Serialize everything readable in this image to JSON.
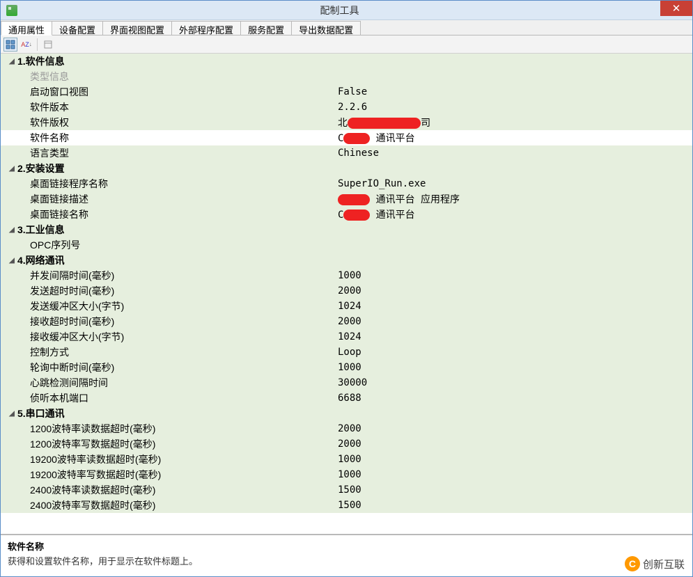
{
  "window": {
    "title": "配制工具"
  },
  "tabs": [
    {
      "label": "通用属性",
      "active": true
    },
    {
      "label": "设备配置"
    },
    {
      "label": "界面视图配置"
    },
    {
      "label": "外部程序配置"
    },
    {
      "label": "服务配置"
    },
    {
      "label": "导出数据配置"
    }
  ],
  "toolbar": {
    "categorized_icon": "categorized-icon",
    "alphabetical_icon": "alphabetical-icon",
    "property_pages_icon": "property-pages-icon"
  },
  "groups": [
    {
      "title": "1.软件信息",
      "rows": [
        {
          "label": "类型信息",
          "value": "",
          "sub": true
        },
        {
          "label": "启动窗口视图",
          "value": "False"
        },
        {
          "label": "软件版本",
          "value": "2.2.6"
        },
        {
          "label": "软件版权",
          "value": "北",
          "redact": "XXXXXXXXXXXX",
          "suffix": "司"
        },
        {
          "label": "软件名称",
          "value": "C",
          "redact": "XXXX",
          "suffix": " 通讯平台",
          "selected": true
        },
        {
          "label": "语言类型",
          "value": "Chinese"
        }
      ]
    },
    {
      "title": "2.安装设置",
      "rows": [
        {
          "label": "桌面链接程序名称",
          "value": "SuperIO_Run.exe"
        },
        {
          "label": "桌面链接描述",
          "value": "",
          "redact": "XXXXX",
          "suffix": " 通讯平台 应用程序"
        },
        {
          "label": "桌面链接名称",
          "value": "C",
          "redact": "XXXX",
          "suffix": " 通讯平台"
        }
      ]
    },
    {
      "title": "3.工业信息",
      "rows": [
        {
          "label": "OPC序列号",
          "value": ""
        }
      ]
    },
    {
      "title": "4.网络通讯",
      "rows": [
        {
          "label": "并发间隔时间(毫秒)",
          "value": "1000"
        },
        {
          "label": "发送超时时间(毫秒)",
          "value": "2000"
        },
        {
          "label": "发送缓冲区大小(字节)",
          "value": "1024"
        },
        {
          "label": "接收超时时间(毫秒)",
          "value": "2000"
        },
        {
          "label": "接收缓冲区大小(字节)",
          "value": "1024"
        },
        {
          "label": "控制方式",
          "value": "Loop"
        },
        {
          "label": "轮询中断时间(毫秒)",
          "value": "1000"
        },
        {
          "label": "心跳检测间隔时间",
          "value": "30000"
        },
        {
          "label": "侦听本机端口",
          "value": "6688"
        }
      ]
    },
    {
      "title": "5.串口通讯",
      "rows": [
        {
          "label": "1200波特率读数据超时(毫秒)",
          "value": "2000"
        },
        {
          "label": "1200波特率写数据超时(毫秒)",
          "value": "2000"
        },
        {
          "label": "19200波特率读数据超时(毫秒)",
          "value": "1000"
        },
        {
          "label": "19200波特率写数据超时(毫秒)",
          "value": "1000"
        },
        {
          "label": "2400波特率读数据超时(毫秒)",
          "value": "1500"
        },
        {
          "label": "2400波特率写数据超时(毫秒)",
          "value": "1500"
        }
      ]
    }
  ],
  "description": {
    "title": "软件名称",
    "text": "获得和设置软件名称，用于显示在软件标题上。"
  },
  "logo": {
    "text": "创新互联",
    "initial": "C"
  }
}
